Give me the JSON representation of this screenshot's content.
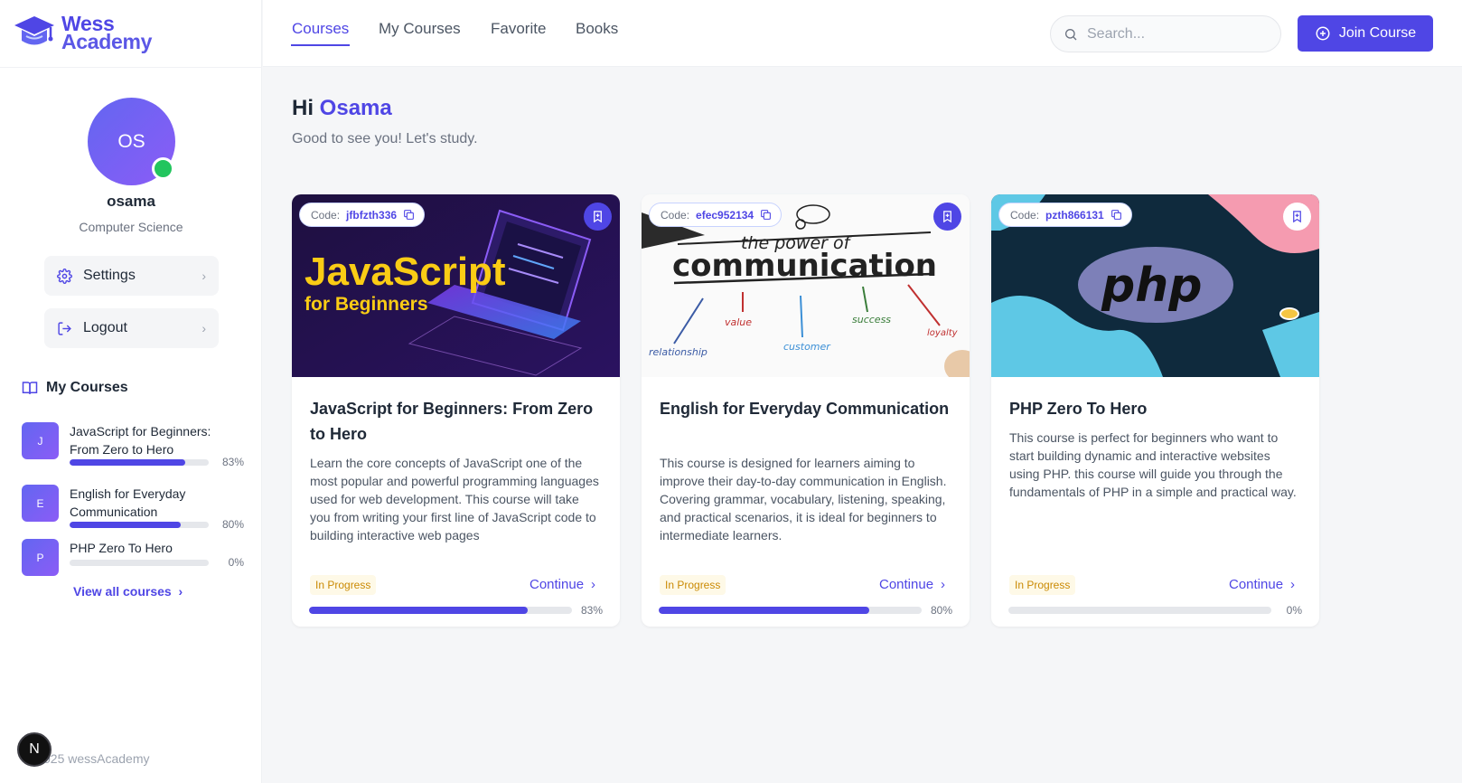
{
  "brand": {
    "line1": "Wess",
    "line2": "Academy",
    "color": "#4f46e5"
  },
  "nav": {
    "tabs": [
      {
        "label": "Courses",
        "active": true
      },
      {
        "label": "My Courses"
      },
      {
        "label": "Favorite"
      },
      {
        "label": "Books"
      }
    ],
    "search_placeholder": "Search...",
    "join_label": "Join Course"
  },
  "user": {
    "initials": "OS",
    "name": "osama",
    "department": "Computer Science"
  },
  "sidebar": {
    "settings_label": "Settings",
    "logout_label": "Logout",
    "my_courses_heading": "My Courses",
    "courses": [
      {
        "initial": "J",
        "title": "JavaScript for Beginners: From Zero to Hero",
        "progress": 0.83,
        "progress_label": "83%"
      },
      {
        "initial": "E",
        "title": "English for Everyday Communication",
        "progress": 0.8,
        "progress_label": "80%"
      },
      {
        "initial": "P",
        "title": "PHP Zero To Hero",
        "progress": 0.0,
        "progress_label": "0%"
      }
    ],
    "view_all_label": "View all courses",
    "copyright": "025 wessAcademy",
    "badge": "N"
  },
  "greeting": {
    "hi": "Hi",
    "name": "Osama",
    "subtitle": "Good to see you! Let's study."
  },
  "cards": [
    {
      "code_prefix": "Code:",
      "code": "jfbfzth336",
      "title": "JavaScript for Beginners: From Zero to Hero",
      "description": "Learn the core concepts of JavaScript one of the most popular and powerful programming languages used for web development. This course will take you from writing your first line of JavaScript code to building interactive web pages",
      "status": "In Progress",
      "continue_label": "Continue",
      "progress": 0.83,
      "progress_label": "83%",
      "image_text": {
        "line1": "JavaScript",
        "line2": "for Beginners"
      }
    },
    {
      "code_prefix": "Code:",
      "code": "efec952134",
      "title": "English for Everyday Communication",
      "description": "This course is designed for learners aiming to improve their day-to-day communication in English. Covering grammar, vocabulary, listening, speaking, and practical scenarios, it is ideal for beginners to intermediate learners.",
      "status": "In Progress",
      "continue_label": "Continue",
      "progress": 0.8,
      "progress_label": "80%",
      "image_text": {
        "line1": "the power of",
        "line2": "communication",
        "words": [
          "relationship",
          "value",
          "customer",
          "success",
          "loyalty"
        ]
      }
    },
    {
      "code_prefix": "Code:",
      "code": "pzth866131",
      "title": "PHP Zero To Hero",
      "description": "This course is perfect for beginners who want to start building dynamic and interactive websites using PHP. this course will guide you through the fundamentals of PHP in a simple and practical way.",
      "status": "In Progress",
      "continue_label": "Continue",
      "progress": 0.0,
      "progress_label": "0%",
      "image_text": {
        "logo": "php"
      }
    }
  ]
}
